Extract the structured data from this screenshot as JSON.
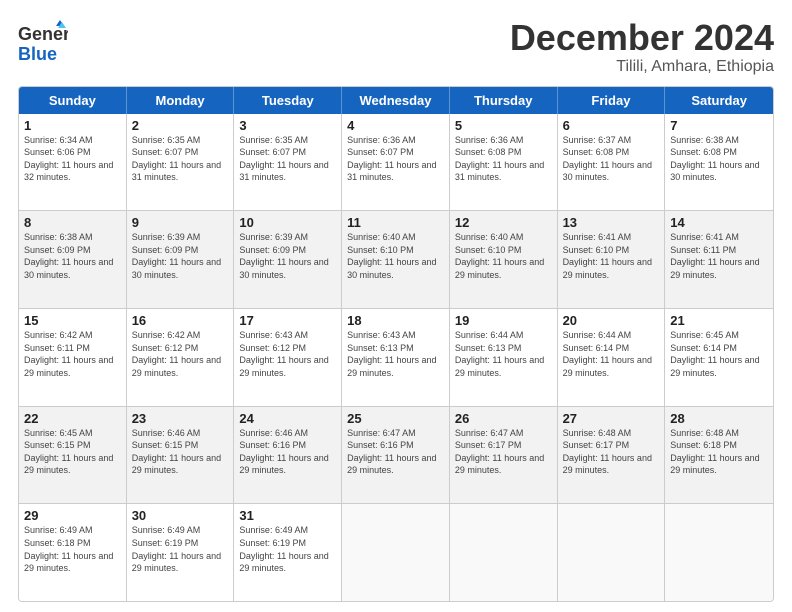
{
  "logo": {
    "line1": "General",
    "line2": "Blue"
  },
  "title": "December 2024",
  "subtitle": "Tilili, Amhara, Ethiopia",
  "weekdays": [
    "Sunday",
    "Monday",
    "Tuesday",
    "Wednesday",
    "Thursday",
    "Friday",
    "Saturday"
  ],
  "rows": [
    [
      {
        "day": "1",
        "sunrise": "Sunrise: 6:34 AM",
        "sunset": "Sunset: 6:06 PM",
        "daylight": "Daylight: 11 hours and 32 minutes.",
        "shaded": false,
        "empty": false
      },
      {
        "day": "2",
        "sunrise": "Sunrise: 6:35 AM",
        "sunset": "Sunset: 6:07 PM",
        "daylight": "Daylight: 11 hours and 31 minutes.",
        "shaded": false,
        "empty": false
      },
      {
        "day": "3",
        "sunrise": "Sunrise: 6:35 AM",
        "sunset": "Sunset: 6:07 PM",
        "daylight": "Daylight: 11 hours and 31 minutes.",
        "shaded": false,
        "empty": false
      },
      {
        "day": "4",
        "sunrise": "Sunrise: 6:36 AM",
        "sunset": "Sunset: 6:07 PM",
        "daylight": "Daylight: 11 hours and 31 minutes.",
        "shaded": false,
        "empty": false
      },
      {
        "day": "5",
        "sunrise": "Sunrise: 6:36 AM",
        "sunset": "Sunset: 6:08 PM",
        "daylight": "Daylight: 11 hours and 31 minutes.",
        "shaded": false,
        "empty": false
      },
      {
        "day": "6",
        "sunrise": "Sunrise: 6:37 AM",
        "sunset": "Sunset: 6:08 PM",
        "daylight": "Daylight: 11 hours and 30 minutes.",
        "shaded": false,
        "empty": false
      },
      {
        "day": "7",
        "sunrise": "Sunrise: 6:38 AM",
        "sunset": "Sunset: 6:08 PM",
        "daylight": "Daylight: 11 hours and 30 minutes.",
        "shaded": false,
        "empty": false
      }
    ],
    [
      {
        "day": "8",
        "sunrise": "Sunrise: 6:38 AM",
        "sunset": "Sunset: 6:09 PM",
        "daylight": "Daylight: 11 hours and 30 minutes.",
        "shaded": true,
        "empty": false
      },
      {
        "day": "9",
        "sunrise": "Sunrise: 6:39 AM",
        "sunset": "Sunset: 6:09 PM",
        "daylight": "Daylight: 11 hours and 30 minutes.",
        "shaded": true,
        "empty": false
      },
      {
        "day": "10",
        "sunrise": "Sunrise: 6:39 AM",
        "sunset": "Sunset: 6:09 PM",
        "daylight": "Daylight: 11 hours and 30 minutes.",
        "shaded": true,
        "empty": false
      },
      {
        "day": "11",
        "sunrise": "Sunrise: 6:40 AM",
        "sunset": "Sunset: 6:10 PM",
        "daylight": "Daylight: 11 hours and 30 minutes.",
        "shaded": true,
        "empty": false
      },
      {
        "day": "12",
        "sunrise": "Sunrise: 6:40 AM",
        "sunset": "Sunset: 6:10 PM",
        "daylight": "Daylight: 11 hours and 29 minutes.",
        "shaded": true,
        "empty": false
      },
      {
        "day": "13",
        "sunrise": "Sunrise: 6:41 AM",
        "sunset": "Sunset: 6:10 PM",
        "daylight": "Daylight: 11 hours and 29 minutes.",
        "shaded": true,
        "empty": false
      },
      {
        "day": "14",
        "sunrise": "Sunrise: 6:41 AM",
        "sunset": "Sunset: 6:11 PM",
        "daylight": "Daylight: 11 hours and 29 minutes.",
        "shaded": true,
        "empty": false
      }
    ],
    [
      {
        "day": "15",
        "sunrise": "Sunrise: 6:42 AM",
        "sunset": "Sunset: 6:11 PM",
        "daylight": "Daylight: 11 hours and 29 minutes.",
        "shaded": false,
        "empty": false
      },
      {
        "day": "16",
        "sunrise": "Sunrise: 6:42 AM",
        "sunset": "Sunset: 6:12 PM",
        "daylight": "Daylight: 11 hours and 29 minutes.",
        "shaded": false,
        "empty": false
      },
      {
        "day": "17",
        "sunrise": "Sunrise: 6:43 AM",
        "sunset": "Sunset: 6:12 PM",
        "daylight": "Daylight: 11 hours and 29 minutes.",
        "shaded": false,
        "empty": false
      },
      {
        "day": "18",
        "sunrise": "Sunrise: 6:43 AM",
        "sunset": "Sunset: 6:13 PM",
        "daylight": "Daylight: 11 hours and 29 minutes.",
        "shaded": false,
        "empty": false
      },
      {
        "day": "19",
        "sunrise": "Sunrise: 6:44 AM",
        "sunset": "Sunset: 6:13 PM",
        "daylight": "Daylight: 11 hours and 29 minutes.",
        "shaded": false,
        "empty": false
      },
      {
        "day": "20",
        "sunrise": "Sunrise: 6:44 AM",
        "sunset": "Sunset: 6:14 PM",
        "daylight": "Daylight: 11 hours and 29 minutes.",
        "shaded": false,
        "empty": false
      },
      {
        "day": "21",
        "sunrise": "Sunrise: 6:45 AM",
        "sunset": "Sunset: 6:14 PM",
        "daylight": "Daylight: 11 hours and 29 minutes.",
        "shaded": false,
        "empty": false
      }
    ],
    [
      {
        "day": "22",
        "sunrise": "Sunrise: 6:45 AM",
        "sunset": "Sunset: 6:15 PM",
        "daylight": "Daylight: 11 hours and 29 minutes.",
        "shaded": true,
        "empty": false
      },
      {
        "day": "23",
        "sunrise": "Sunrise: 6:46 AM",
        "sunset": "Sunset: 6:15 PM",
        "daylight": "Daylight: 11 hours and 29 minutes.",
        "shaded": true,
        "empty": false
      },
      {
        "day": "24",
        "sunrise": "Sunrise: 6:46 AM",
        "sunset": "Sunset: 6:16 PM",
        "daylight": "Daylight: 11 hours and 29 minutes.",
        "shaded": true,
        "empty": false
      },
      {
        "day": "25",
        "sunrise": "Sunrise: 6:47 AM",
        "sunset": "Sunset: 6:16 PM",
        "daylight": "Daylight: 11 hours and 29 minutes.",
        "shaded": true,
        "empty": false
      },
      {
        "day": "26",
        "sunrise": "Sunrise: 6:47 AM",
        "sunset": "Sunset: 6:17 PM",
        "daylight": "Daylight: 11 hours and 29 minutes.",
        "shaded": true,
        "empty": false
      },
      {
        "day": "27",
        "sunrise": "Sunrise: 6:48 AM",
        "sunset": "Sunset: 6:17 PM",
        "daylight": "Daylight: 11 hours and 29 minutes.",
        "shaded": true,
        "empty": false
      },
      {
        "day": "28",
        "sunrise": "Sunrise: 6:48 AM",
        "sunset": "Sunset: 6:18 PM",
        "daylight": "Daylight: 11 hours and 29 minutes.",
        "shaded": true,
        "empty": false
      }
    ],
    [
      {
        "day": "29",
        "sunrise": "Sunrise: 6:49 AM",
        "sunset": "Sunset: 6:18 PM",
        "daylight": "Daylight: 11 hours and 29 minutes.",
        "shaded": false,
        "empty": false
      },
      {
        "day": "30",
        "sunrise": "Sunrise: 6:49 AM",
        "sunset": "Sunset: 6:19 PM",
        "daylight": "Daylight: 11 hours and 29 minutes.",
        "shaded": false,
        "empty": false
      },
      {
        "day": "31",
        "sunrise": "Sunrise: 6:49 AM",
        "sunset": "Sunset: 6:19 PM",
        "daylight": "Daylight: 11 hours and 29 minutes.",
        "shaded": false,
        "empty": false
      },
      {
        "day": "",
        "sunrise": "",
        "sunset": "",
        "daylight": "",
        "shaded": false,
        "empty": true
      },
      {
        "day": "",
        "sunrise": "",
        "sunset": "",
        "daylight": "",
        "shaded": false,
        "empty": true
      },
      {
        "day": "",
        "sunrise": "",
        "sunset": "",
        "daylight": "",
        "shaded": false,
        "empty": true
      },
      {
        "day": "",
        "sunrise": "",
        "sunset": "",
        "daylight": "",
        "shaded": false,
        "empty": true
      }
    ]
  ]
}
